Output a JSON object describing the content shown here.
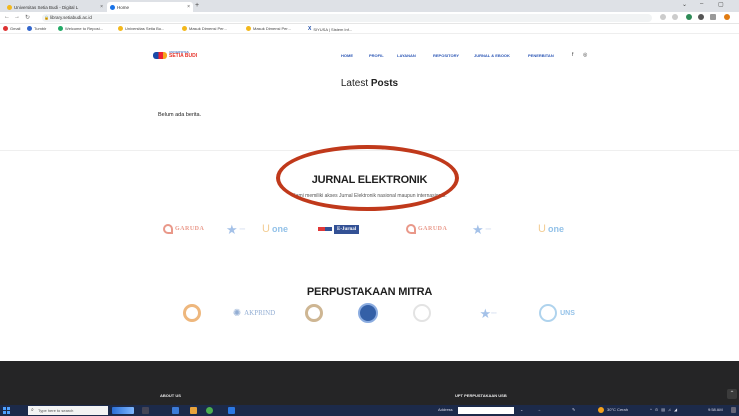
{
  "browser": {
    "tabs": [
      {
        "label": "Universitas Setia Budi - Digital L",
        "active": false
      },
      {
        "label": "Home",
        "active": true
      }
    ],
    "url": "library.setiabudi.ac.id",
    "bookmarks": [
      "Gmail",
      "Tumblr",
      "Welcome to Reposi...",
      "Universitas Setia Bu...",
      "Masuk Dimensi Per...",
      "Masuk Dimensi Per...",
      "SIYUSA | Sistem Inf..."
    ]
  },
  "site": {
    "logo_text": "SETIA BUDI",
    "logo_sub": "UNIVERSITAS",
    "menu": [
      "HOME",
      "PROFIL",
      "LAYANAN",
      "REPOSITORY",
      "JURNAL & EBOOK",
      "PENERBITAN"
    ]
  },
  "latest": {
    "title_plain": "Latest",
    "title_bold": "Posts",
    "empty_text": "Belum ada berita."
  },
  "jurnal": {
    "title": "JURNAL ELEKTRONIK",
    "subtitle": "Kami memiliki akses Jurnal Elektronik nasional maupun internasional.",
    "logos": [
      "GARUDA",
      "one",
      "E-Jurnal",
      "GARUDA",
      "one"
    ]
  },
  "mitra": {
    "title": "PERPUSTAKAAN MITRA",
    "logos": [
      "AKPRIND",
      "UNS"
    ]
  },
  "footer": {
    "about": "ABOUT US",
    "upt": "UPT PERPUSTAKAAN USB"
  },
  "taskbar": {
    "search_placeholder": "Type here to search",
    "address_label": "Address",
    "weather": "30°C Cerah",
    "time": "9:58 AM"
  },
  "colors": {
    "accent": "#2b56b5",
    "annotation": "#c0391b",
    "footer": "#252526"
  }
}
